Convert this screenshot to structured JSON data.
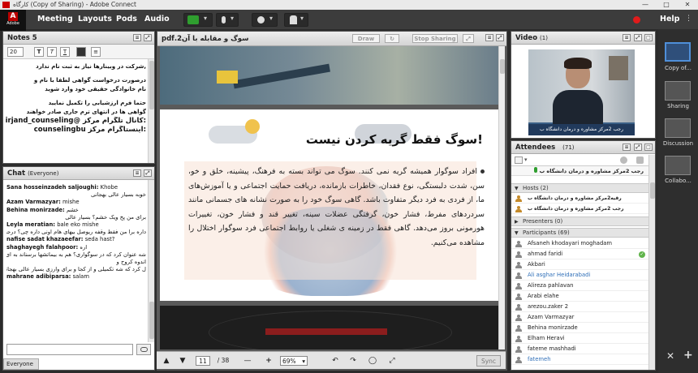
{
  "window": {
    "title": "کارگاه (Copy of Sharing) - Adobe Connect"
  },
  "logo": {
    "label": "Adobe"
  },
  "menu": {
    "items": [
      "Meeting",
      "Layouts",
      "Pods",
      "Audio"
    ],
    "help": "Help"
  },
  "notes": {
    "title": "Notes 5",
    "font_size": "20",
    "lines": [
      ",شرکت در وبینارها نیاز به ثبت نام ندارد",
      "درصورت درخواست گواهی لطفا با نام و",
      "نام خانوادگی حقیقی خود وارد شوید",
      "حتما فرم ارزشیابی را تکمیل نمایید",
      "گواهی ها در انتهای ترم جاری صادر خواهند",
      ":کانال تلگرام مرکز @birjand_counseling",
      ":اینستاگرام مرکز counselingbu"
    ]
  },
  "chat": {
    "title": "Chat",
    "scope": "(Everyone)",
    "messages": [
      {
        "name": "Sana hosseinzadeh saljoughi:",
        "text": "Khobe"
      },
      {
        "name": "",
        "text": "خوبه بسیار عالی بهجانی"
      },
      {
        "name": "Azam Varmazyar:",
        "text": "mishe"
      },
      {
        "name": "Behina monirzade:",
        "text": "خشم"
      },
      {
        "name": "",
        "text": "برای من پخ ویک خشم؟ بسیار عالی"
      },
      {
        "name": "Leyla meratian:",
        "text": "bale eko mishe"
      },
      {
        "name": "",
        "text": "داره برا من فقط وقفه ریوصل بیهای هام اونی داره چی؟ درجه نا آوچی هان"
      },
      {
        "name": "nafise sadat khazaeefar:",
        "text": "seda hast?"
      },
      {
        "name": "shaghayegh falahpoor:",
        "text": "اره"
      },
      {
        "name": "",
        "text": "شه عنوان کرد که در سوگواری؟ هم به بیماتشها برسناند به ای؟ درجه نا آوچی هان"
      },
      {
        "name": "",
        "text": "اندوه کروح و"
      },
      {
        "name": "",
        "text": "ل کرد که شه تکمیلی و از کجا و برای وارزی بسیار عالی بهجانی"
      },
      {
        "name": "mahrane adibiparsa:",
        "text": "salam"
      }
    ],
    "target": "Everyone"
  },
  "share": {
    "doc_title": "سوگ و مقابله با آن2.pdf",
    "draw_label": "Draw",
    "stop_label": "Stop Sharing",
    "slide_title": "!سوگ فقط گریه کردن نیست",
    "slide_text": "افراد سوگوار همیشه گریه نمی کنند. سوگ می تواند بسته به فرهنگ، پیشینه، خلق و خو، سن، شدت دلبستگی، نوع فقدان، خاطرات بازمانده، دریافت حمایت اجتماعی و یا آموزش‌های ما، از فردی به فرد دیگر متفاوت باشد. گاهی سوگ خود را به صورت نشانه های جسمانی مانند سردردهای مفرط، فشار خون، گرفتگی عضلات سینه، تغییر قند و فشار خون، تغییرات هورمونی بروز می‌دهد. گاهی فقط در زمینه ی شغلی یا روابط اجتماعی فرد سوگوار اختلال را مشاهده می‌کنیم.",
    "page_current": "11",
    "page_total": "/ 38",
    "zoom": "69%",
    "sync_label": "Sync"
  },
  "video": {
    "title": "Video",
    "count": "(1)",
    "caption": "رجب 2مرکز مشاوره و درمان دانشگاه ب"
  },
  "attendees": {
    "title": "Attendees",
    "count": "(71)",
    "active_speaker": "رجب 2مرکز مشاوره و درمان دانشگاه ب",
    "hosts_label": "Hosts (2)",
    "hosts": [
      "رقیه2مرکز مشاوره و درمان دانشگاه ب",
      "رجب 2مرکز مشاوره و درمان دانشگاه ب"
    ],
    "presenters_label": "Presenters (0)",
    "participants_label": "Participants (69)",
    "participants": [
      "Afsaneh khodayari moghadam",
      "ahmad faridi",
      "Akbari",
      "Ali asghar Heidarabadi",
      "Alireza pahlavan",
      "Arabi elahe",
      "arezou.zaker 2",
      "Azam Varmazyar",
      "Behina monirzade",
      "Elham Heravi",
      "fateme mashhadi",
      "fatemeh"
    ]
  },
  "layouts": {
    "items": [
      "Copy of...",
      "Sharing",
      "Discussion",
      "Collabo..."
    ]
  }
}
